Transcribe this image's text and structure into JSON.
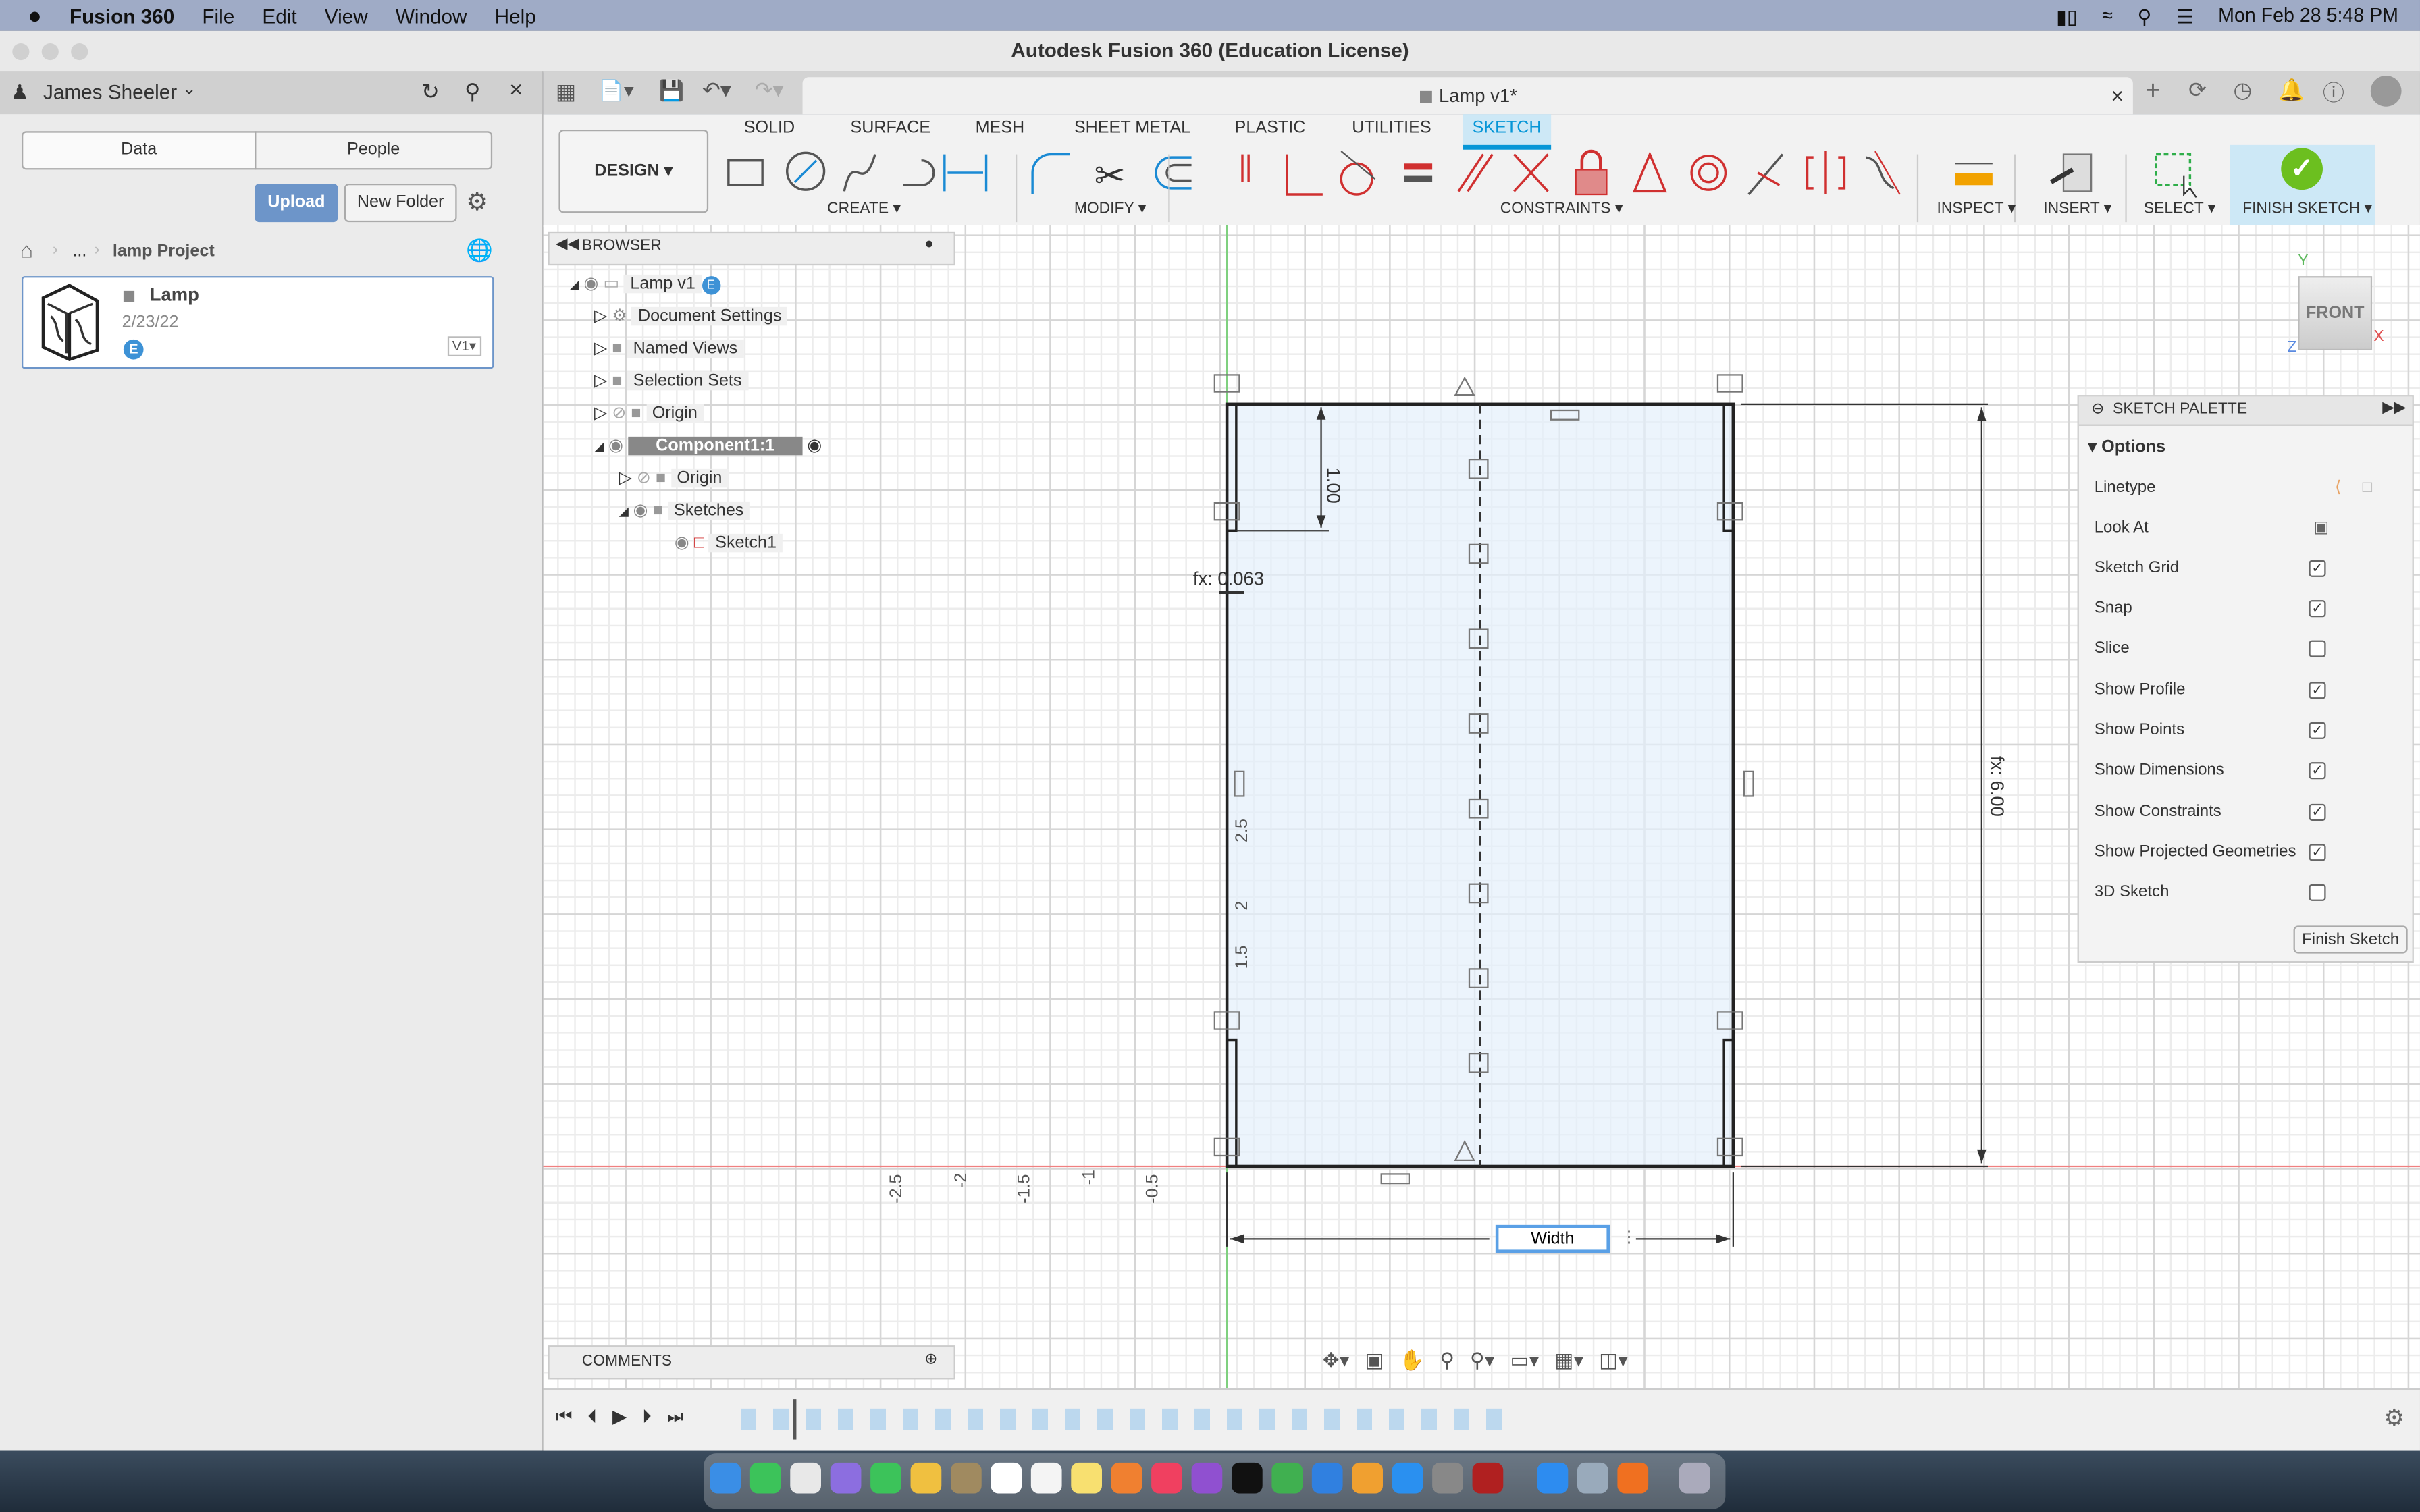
{
  "menubar": {
    "apple": "",
    "app": "Fusion 360",
    "items": [
      "File",
      "Edit",
      "View",
      "Window",
      "Help"
    ],
    "datetime": "Mon Feb 28  5:48 PM"
  },
  "window": {
    "title": "Autodesk Fusion 360 (Education License)"
  },
  "data_panel": {
    "user": "James Sheeler",
    "tabs": [
      "Data",
      "People"
    ],
    "upload": "Upload",
    "new_folder": "New Folder",
    "breadcrumb_ellipsis": "...",
    "project": "lamp Project",
    "file": {
      "name": "Lamp",
      "date": "2/23/22",
      "version": "V1",
      "badge": "E"
    }
  },
  "document": {
    "tab_title": "Lamp v1*"
  },
  "toolbar": {
    "workspace": "DESIGN",
    "tabs": [
      "SOLID",
      "SURFACE",
      "MESH",
      "SHEET METAL",
      "PLASTIC",
      "UTILITIES",
      "SKETCH"
    ],
    "active_tab": "SKETCH",
    "groups": [
      "CREATE",
      "MODIFY",
      "CONSTRAINTS",
      "INSPECT",
      "INSERT",
      "SELECT",
      "FINISH SKETCH"
    ]
  },
  "browser": {
    "title": "BROWSER",
    "items": [
      {
        "label": "Lamp v1",
        "badge": "E"
      },
      {
        "label": "Document Settings"
      },
      {
        "label": "Named Views"
      },
      {
        "label": "Selection Sets"
      },
      {
        "label": "Origin"
      },
      {
        "label": "Component1:1"
      },
      {
        "label": "Origin"
      },
      {
        "label": "Sketches"
      },
      {
        "label": "Sketch1"
      }
    ]
  },
  "comments": {
    "title": "COMMENTS"
  },
  "viewcube": {
    "face": "FRONT",
    "x": "X",
    "y": "Y",
    "z": "Z"
  },
  "sketch": {
    "dim_top": "1.00",
    "dim_thickness": "fx: 0.063",
    "dim_height": "fx: 6.00",
    "width_input": "Width",
    "ruler_x": [
      "-2.5",
      "-2",
      "-1.5",
      "-1",
      "-0.5"
    ],
    "ruler_y": [
      "2.5",
      "2",
      "1.5"
    ]
  },
  "palette": {
    "title": "SKETCH PALETTE",
    "section": "Options",
    "rows": [
      {
        "label": "Linetype",
        "type": "icons"
      },
      {
        "label": "Look At",
        "type": "icon"
      },
      {
        "label": "Sketch Grid",
        "checked": true
      },
      {
        "label": "Snap",
        "checked": true
      },
      {
        "label": "Slice",
        "checked": false
      },
      {
        "label": "Show Profile",
        "checked": true
      },
      {
        "label": "Show Points",
        "checked": true
      },
      {
        "label": "Show Dimensions",
        "checked": true
      },
      {
        "label": "Show Constraints",
        "checked": true
      },
      {
        "label": "Show Projected Geometries",
        "checked": true
      },
      {
        "label": "3D Sketch",
        "checked": false
      }
    ],
    "finish": "Finish Sketch"
  },
  "colors": {
    "accent": "#0696d7",
    "finish_green": "#6cbf1f",
    "constraint_red": "#d03030",
    "upload_blue": "#6d95c9"
  }
}
